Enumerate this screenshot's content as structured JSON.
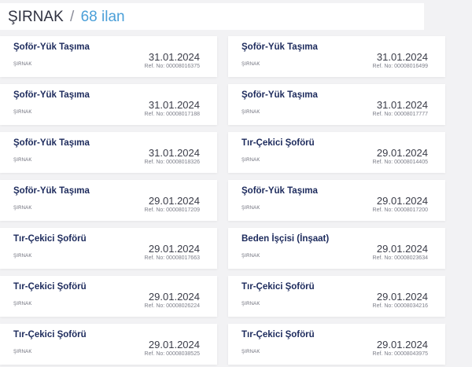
{
  "header": {
    "city": "ŞIRNAK",
    "separator": "/",
    "count": "68 ilan"
  },
  "listings": [
    {
      "title": "Şoför-Yük Taşıma",
      "city": "ŞIRNAK",
      "date": "31.01.2024",
      "ref": "Ref. No: 00008016375"
    },
    {
      "title": "Şoför-Yük Taşıma",
      "city": "ŞIRNAK",
      "date": "31.01.2024",
      "ref": "Ref. No: 00008016499"
    },
    {
      "title": "Şoför-Yük Taşıma",
      "city": "ŞIRNAK",
      "date": "31.01.2024",
      "ref": "Ref. No: 00008017188"
    },
    {
      "title": "Şoför-Yük Taşıma",
      "city": "ŞIRNAK",
      "date": "31.01.2024",
      "ref": "Ref. No: 00008017777"
    },
    {
      "title": "Şoför-Yük Taşıma",
      "city": "ŞIRNAK",
      "date": "31.01.2024",
      "ref": "Ref. No: 00008018326"
    },
    {
      "title": "Tır-Çekici Şoförü",
      "city": "ŞIRNAK",
      "date": "29.01.2024",
      "ref": "Ref. No: 00008014405"
    },
    {
      "title": "Şoför-Yük Taşıma",
      "city": "ŞIRNAK",
      "date": "29.01.2024",
      "ref": "Ref. No: 00008017209"
    },
    {
      "title": "Şoför-Yük Taşıma",
      "city": "ŞIRNAK",
      "date": "29.01.2024",
      "ref": "Ref. No: 00008017200"
    },
    {
      "title": "Tır-Çekici Şoförü",
      "city": "ŞIRNAK",
      "date": "29.01.2024",
      "ref": "Ref. No: 00008017663"
    },
    {
      "title": "Beden İşçisi (İnşaat)",
      "city": "ŞIRNAK",
      "date": "29.01.2024",
      "ref": "Ref. No: 00008023634"
    },
    {
      "title": "Tır-Çekici Şoförü",
      "city": "ŞIRNAK",
      "date": "29.01.2024",
      "ref": "Ref. No: 00008026224"
    },
    {
      "title": "Tır-Çekici Şoförü",
      "city": "ŞIRNAK",
      "date": "29.01.2024",
      "ref": "Ref. No: 00008034216"
    },
    {
      "title": "Tır-Çekici Şoförü",
      "city": "ŞIRNAK",
      "date": "29.01.2024",
      "ref": "Ref. No: 00008038525"
    },
    {
      "title": "Tır-Çekici Şoförü",
      "city": "ŞIRNAK",
      "date": "29.01.2024",
      "ref": "Ref. No: 00008043975"
    }
  ]
}
